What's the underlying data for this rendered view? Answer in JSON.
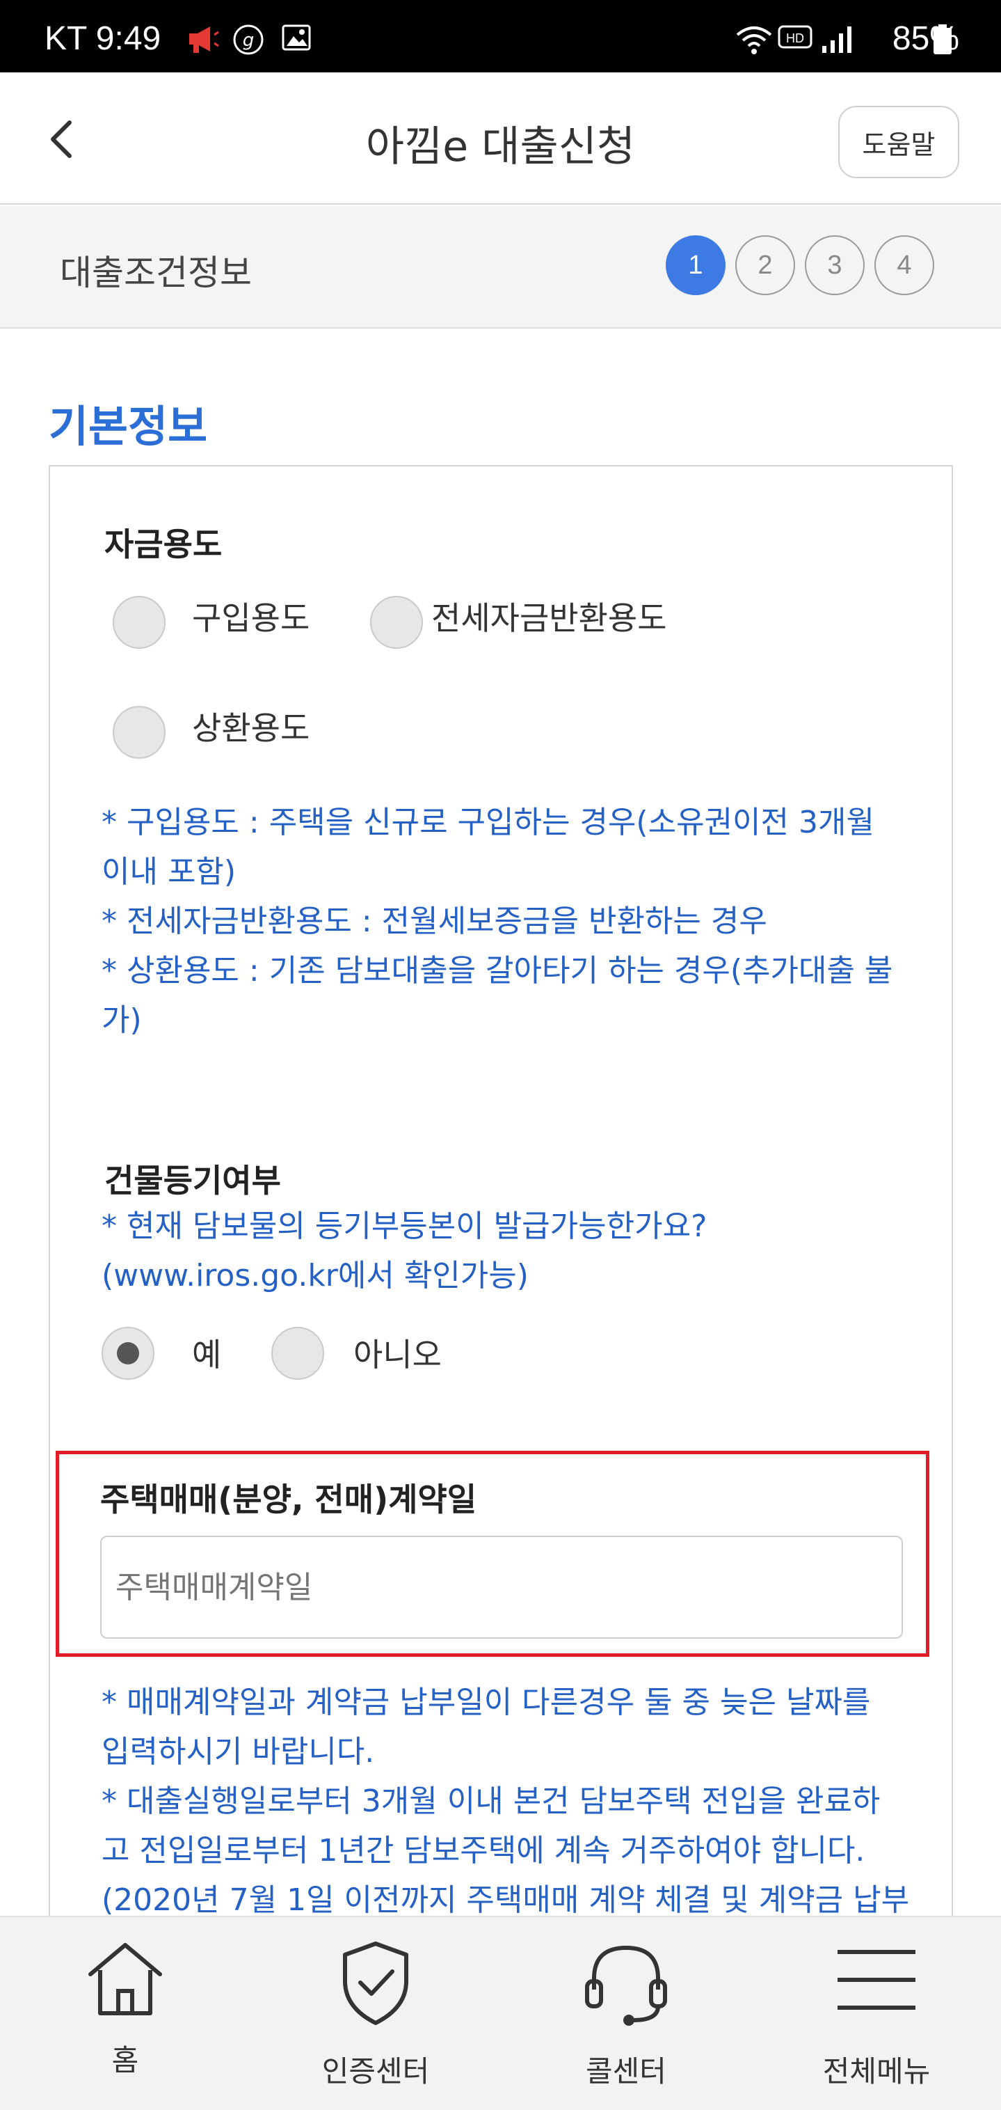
{
  "status_bar": {
    "carrier_time": "KT 9:49",
    "battery": "85%",
    "hd_label": "HD"
  },
  "header": {
    "title": "아낌e 대출신청",
    "help_label": "도움말"
  },
  "stepbar": {
    "title": "대출조건정보",
    "steps": [
      "1",
      "2",
      "3",
      "4"
    ],
    "active_step": 1
  },
  "section": {
    "title": "기본정보"
  },
  "fund_purpose": {
    "label": "자금용도",
    "options": [
      "구입용도",
      "전세자금반환용도",
      "상환용도"
    ],
    "notes": [
      "* 구입용도 : 주택을 신규로 구입하는 경우(소유권이전 3개월",
      "이내 포함)",
      "* 전세자금반환용도 : 전월세보증금을 반환하는 경우",
      "* 상환용도 : 기존 담보대출을 갈아타기 하는 경우(추가대출 불",
      "가)"
    ]
  },
  "registry": {
    "label": "건물등기여부",
    "notes": [
      "* 현재 담보물의 등기부등본이 발급가능한가요?",
      "(www.iros.go.kr에서 확인가능)"
    ],
    "options": [
      "예",
      "아니오"
    ],
    "selected": "예"
  },
  "contract_date": {
    "label": "주택매매(분양, 전매)계약일",
    "placeholder": "주택매매계약일",
    "notes": [
      "* 매매계약일과 계약금 납부일이 다른경우 둘 중 늦은 날짜를",
      "입력하시기 바랍니다.",
      "* 대출실행일로부터 3개월 이내 본건 담보주택 전입을 완료하",
      "고 전입일로부터 1년간 담보주택에 계속 거주하여야 합니다.",
      "(2020년 7월 1일 이전까지 주택매매 계약 체결 및 계약금 납부"
    ]
  },
  "bottom_nav": {
    "items": [
      "홈",
      "인증센터",
      "콜센터",
      "전체메뉴"
    ]
  },
  "colors": {
    "accent": "#3d7ae3",
    "note_blue": "#2560c4",
    "highlight_red": "#e21d2a"
  }
}
